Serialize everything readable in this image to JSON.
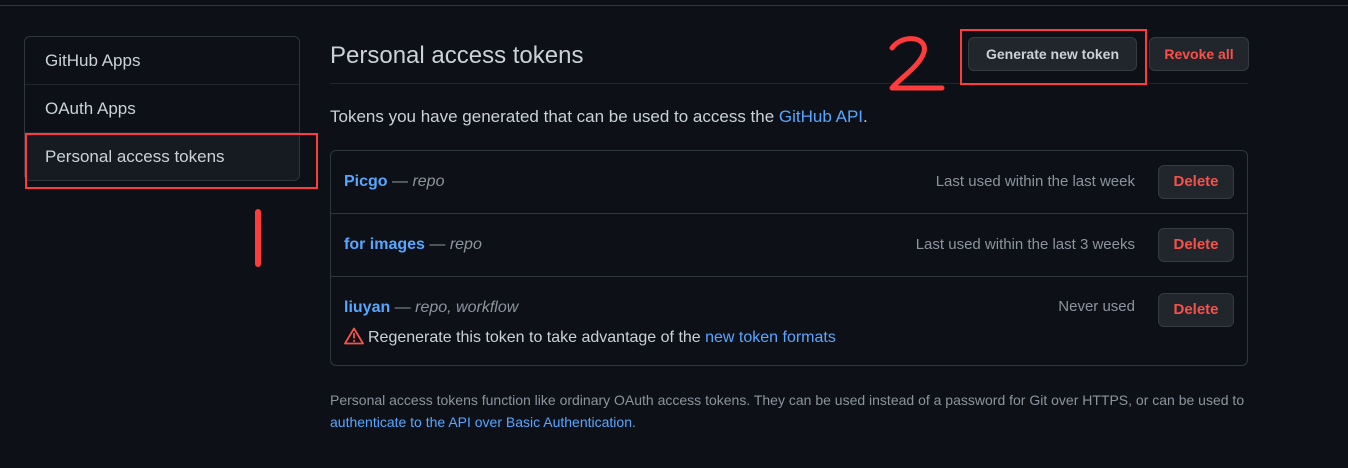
{
  "sidebar": {
    "items": [
      {
        "label": "GitHub Apps"
      },
      {
        "label": "OAuth Apps"
      },
      {
        "label": "Personal access tokens"
      }
    ]
  },
  "annotations": {
    "step1": "1",
    "step2": "2",
    "color": "#ff3b3b"
  },
  "main": {
    "title": "Personal access tokens",
    "generate_label": "Generate new token",
    "revoke_label": "Revoke all",
    "description": {
      "text": "Tokens you have generated that can be used to access the ",
      "link": "GitHub API",
      "end": "."
    },
    "tokens": [
      {
        "name": "Picgo",
        "sep": " — ",
        "scope": "repo",
        "last_used": "Last used within the last week",
        "delete_label": "Delete"
      },
      {
        "name": "for images",
        "sep": " — ",
        "scope": "repo",
        "last_used": "Last used within the last 3 weeks",
        "delete_label": "Delete"
      },
      {
        "name": "liuyan",
        "sep": " — ",
        "scope": "repo, workflow",
        "last_used": "Never used",
        "delete_label": "Delete",
        "warning": {
          "text": "Regenerate this token to take advantage of the ",
          "link": "new token formats",
          "icon": "alert-triangle-icon"
        }
      }
    ],
    "footnote": {
      "text": "Personal access tokens function like ordinary OAuth access tokens. They can be used instead of a password for Git over HTTPS, or can be used to ",
      "link": "authenticate to the API over Basic Authentication",
      "end": "."
    }
  },
  "colors": {
    "background": "#0d1117",
    "link": "#58a6ff",
    "danger": "#f85149",
    "muted": "#8b949e"
  }
}
